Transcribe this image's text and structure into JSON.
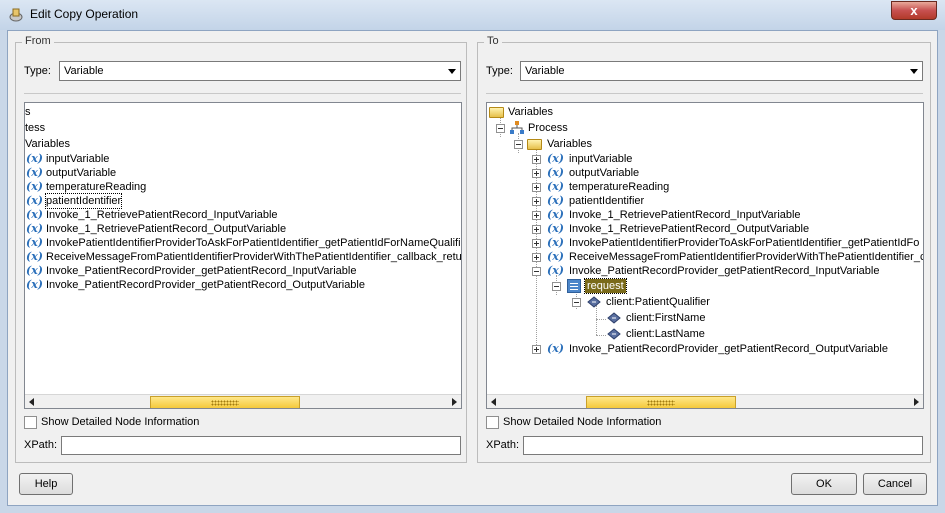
{
  "window": {
    "title": "Edit Copy Operation",
    "close_glyph": "x"
  },
  "from": {
    "group_title": "From",
    "type_label": "Type:",
    "type_value": "Variable",
    "partial_rows": [
      "s",
      "tess",
      "Variables"
    ],
    "variables": [
      "inputVariable",
      "outputVariable",
      "temperatureReading",
      "patientIdentifier",
      "Invoke_1_RetrievePatientRecord_InputVariable",
      "Invoke_1_RetrievePatientRecord_OutputVariable",
      "InvokePatientIdentifierProviderToAskForPatientIdentifier_getPatientIdForNameQualifi",
      "ReceiveMessageFromPatientIdentifierProviderWithThePatientIdentifier_callback_retur",
      "Invoke_PatientRecordProvider_getPatientRecord_InputVariable",
      "Invoke_PatientRecordProvider_getPatientRecord_OutputVariable"
    ],
    "selected_variable": "patientIdentifier",
    "show_details_label": "Show Detailed Node Information",
    "xpath_label": "XPath:",
    "xpath_value": ""
  },
  "to": {
    "group_title": "To",
    "type_label": "Type:",
    "type_value": "Variable",
    "root_label": "Variables",
    "process_label": "Process",
    "variables_folder_label": "Variables",
    "variables": [
      "inputVariable",
      "outputVariable",
      "temperatureReading",
      "patientIdentifier",
      "Invoke_1_RetrievePatientRecord_InputVariable",
      "Invoke_1_RetrievePatientRecord_OutputVariable",
      "InvokePatientIdentifierProviderToAskForPatientIdentifier_getPatientIdFo",
      "ReceiveMessageFromPatientIdentifierProviderWithThePatientIdentifier_ca",
      "Invoke_PatientRecordProvider_getPatientRecord_InputVariable"
    ],
    "request_label": "request",
    "qualifier_label": "client:PatientQualifier",
    "first_name_label": "client:FirstName",
    "last_name_label": "client:LastName",
    "last_variable": "Invoke_PatientRecordProvider_getPatientRecord_OutputVariable",
    "show_details_label": "Show Detailed Node Information",
    "xpath_label": "XPath:",
    "xpath_value": ""
  },
  "buttons": {
    "help": "Help",
    "ok": "OK",
    "cancel": "Cancel"
  },
  "scrollbars": {
    "from_position": 0.43,
    "to_position": 0.33
  },
  "icons": {
    "variable": "variable-x-icon",
    "folder": "folder-icon",
    "process": "process-icon",
    "element": "element-diamond-icon",
    "request": "message-part-icon"
  },
  "colors": {
    "variable_icon": "#2a6fba",
    "selection": "#7a6a1a",
    "scroll_thumb": "#f5c93b"
  }
}
